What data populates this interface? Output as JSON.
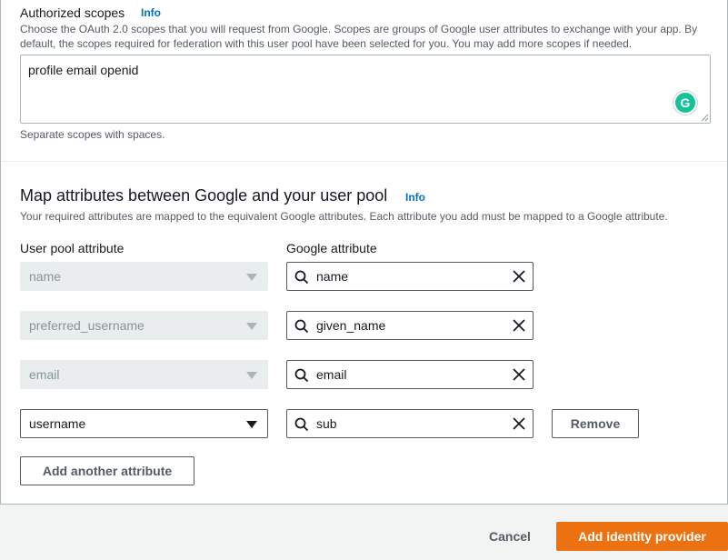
{
  "scopes": {
    "label": "Authorized scopes",
    "info": "Info",
    "description": "Choose the OAuth 2.0 scopes that you will request from Google. Scopes are groups of Google user attributes to exchange with your app. By default, the scopes required for federation with this user pool have been selected for you. You may add more scopes if needed.",
    "value": "profile email openid",
    "hint": "Separate scopes with spaces."
  },
  "mapping": {
    "title": "Map attributes between Google and your user pool",
    "info": "Info",
    "description": "Your required attributes are mapped to the equivalent Google attributes. Each attribute you add must be mapped to a Google attribute.",
    "col_user_pool": "User pool attribute",
    "col_google": "Google attribute",
    "rows": [
      {
        "user_pool": "name",
        "google": "name",
        "disabled": true
      },
      {
        "user_pool": "preferred_username",
        "google": "given_name",
        "disabled": true
      },
      {
        "user_pool": "email",
        "google": "email",
        "disabled": true
      },
      {
        "user_pool": "username",
        "google": "sub",
        "disabled": false
      }
    ],
    "remove_label": "Remove",
    "add_label": "Add another attribute"
  },
  "footer": {
    "cancel_label": "Cancel",
    "submit_label": "Add identity provider"
  },
  "colors": {
    "primary": "#ec7211",
    "link": "#0073bb",
    "grammarly": "#15c39a"
  },
  "icons": [
    "search-icon",
    "clear-icon",
    "caret-down-icon",
    "grammarly-icon",
    "resize-handle-icon"
  ]
}
